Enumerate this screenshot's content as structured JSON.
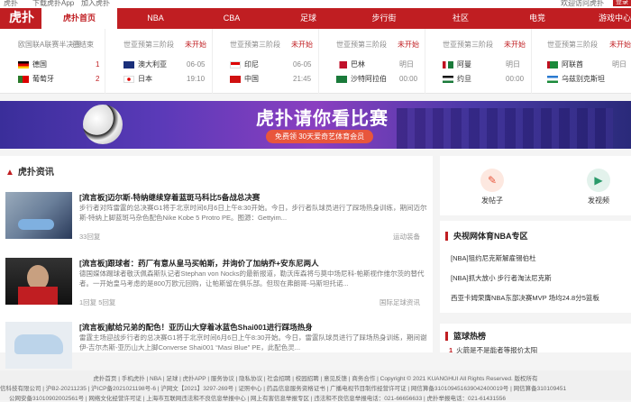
{
  "topbar": {
    "left": "虎扑",
    "app": "下载虎扑App",
    "join": "加入虎扑",
    "right": "欢迎访问虎扑",
    "badge": "登录"
  },
  "nav": {
    "logo": "虎扑",
    "items": [
      "虎扑首页",
      "NBA",
      "CBA",
      "足球",
      "步行街",
      "社区",
      "电竞",
      "游戏中心"
    ]
  },
  "matches": [
    {
      "stage": "欧国联A联赛半决赛",
      "state": "已结束",
      "team1": "德国",
      "val1": "1",
      "team2": "葡萄牙",
      "val2": "2",
      "color1": "#000000",
      "color2": "#2a7a2a"
    },
    {
      "stage": "世亚预第三阶段",
      "state": "未开始",
      "team1": "澳大利亚",
      "val1": "06-05",
      "team2": "日本",
      "val2": "19:10",
      "color1": "#1a2f7a",
      "color2": "#ffffff"
    },
    {
      "stage": "世亚预第三阶段",
      "state": "未开始",
      "team1": "印尼",
      "val1": "06-05",
      "team2": "中国",
      "val2": "21:45",
      "color1": "#d01010",
      "color2": "#d01010"
    },
    {
      "stage": "世亚预第三阶段",
      "state": "未开始",
      "team1": "巴林",
      "val1": "明日",
      "team2": "沙特阿拉伯",
      "val2": "00:00",
      "color1": "#c0102a",
      "color2": "#1a7a3a"
    },
    {
      "stage": "世亚预第三阶段",
      "state": "未开始",
      "team1": "阿曼",
      "val1": "明日",
      "team2": "约旦",
      "val2": "00:00",
      "color1": "#c01020",
      "color2": "#1a1a1a"
    },
    {
      "stage": "世亚预第三阶段",
      "state": "未开始",
      "team1": "阿联酋",
      "val1": "明日",
      "team2": "乌兹别克斯坦",
      "val2": "",
      "color1": "#1a8a3a",
      "color2": "#2a7ad0"
    }
  ],
  "banner": {
    "title": "虎扑请你看比赛",
    "subtitle": "免费领 30天爱奇艺体育会员"
  },
  "main": {
    "heading": "虎扑资讯",
    "articles": [
      {
        "title": "[流言板]迈尔斯-特纳继续穿着蓝斑马科比5备战总决赛",
        "desc": "步行者对阵雷霆的总决赛G1将于北京时间6月6日上午8:30开始。今日，步行者队球员进行了踩场热身训练，期间迈尔斯-特纳上脚蓝斑马杂色配色Nike Kobe 5 Protro PE。图源：Gettyim...",
        "replies": "33回复",
        "tag": "运动装备"
      },
      {
        "title": "[流言板]跟球者：药厂有意从皇马买帕斯，并询价了加纳乔+安东尼两人",
        "desc": "德国媒体踢球者敬沃佩森斯队记者Stephan von Nocks的最新报道，勒沃库森将与莫中场尼科-帕斯视作维尔茨的替代者。一开始皇马考虑的是800万欧元回购，让帕斯留在俱乐部。但现在弗朗哥-马斯坦托诺...",
        "replies": "1回复  5回复",
        "tag": "国际足球资讯"
      },
      {
        "title": "[流言板]献给兄弟的配色！亚历山大穿着冰蓝色Shai001进行踩场热身",
        "desc": "雷霆主场迎战步行者的总决赛G1将于北京时间6月6日上午8:30开始。今日，雷霆队球员进行了踩场热身训练，期间谢伊-吉尔杰斯-亚历山大上脚Converse Shai001 “Masi Blue” PE，此配色灵...",
        "replies": "33回复",
        "tag": "运动装备"
      }
    ]
  },
  "side": {
    "post": "发帖子",
    "video": "发视频",
    "nba_heading": "央视网体育NBA专区",
    "nba_items": [
      "[NBA]狙约尼克斯解雇锡伯杜",
      "[NBA]抓大放小 步行者淘汰尼克斯",
      "西亚卡姆荣膺NBA东部决赛MVP 场均24.8分5篮板"
    ],
    "hot_heading": "篮球热榜",
    "hot_num": "1",
    "hot_item": "火箭是不是能者等报价太阳"
  },
  "footer": {
    "line1": "虎扑首页 | 手机虎扑 | NBA | 足球 | 虎扑APP | 服务协议 | 隐私协议 | 社会招聘 | 校园招聘 | 意见反馈 | 商务合作 | Copyright © 2021 KUANGHUI All Rights Reserved. 版权所有",
    "line2": "信科技有限公司 | 沪B2-20211235 | 沪ICP备2021021198号-6 | 沪网文【2021】3297-269号 | 证照中心 | 药品信息服务资格证书 | 广播电视节目制作经营许可证 | 网信算备310109451639042400019号 | 网信算备310109451",
    "line3": "公网安备31010902002561号 | 网络文化经营许可证 | 上海市互联网违法和不良信息举报中心 | 网上有害信息举报专区 | 违法和不良信息举报电话：021-66656633 | 虎扑举报电话：021-61431556"
  }
}
